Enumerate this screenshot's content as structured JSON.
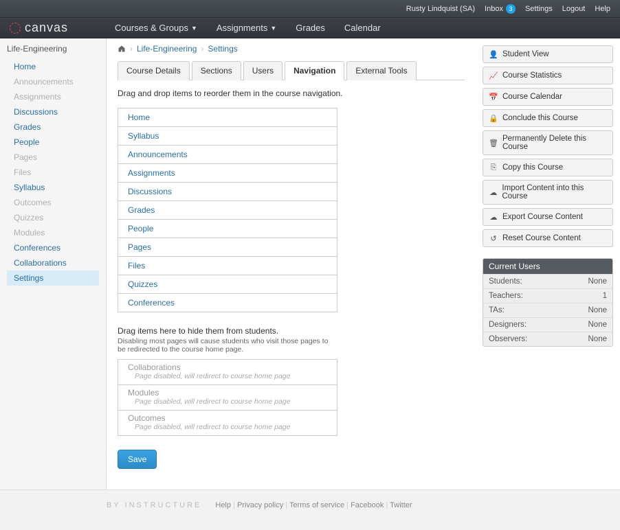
{
  "topbar": {
    "user": "Rusty Lindquist (SA)",
    "inbox_label": "Inbox",
    "inbox_count": "3",
    "settings": "Settings",
    "logout": "Logout",
    "help": "Help"
  },
  "brand": {
    "name": "canvas"
  },
  "mainnav": {
    "courses": "Courses & Groups",
    "assignments": "Assignments",
    "grades": "Grades",
    "calendar": "Calendar"
  },
  "sidebar": {
    "header": "Life-Engineering",
    "items": [
      {
        "label": "Home",
        "disabled": false
      },
      {
        "label": "Announcements",
        "disabled": true
      },
      {
        "label": "Assignments",
        "disabled": true
      },
      {
        "label": "Discussions",
        "disabled": false
      },
      {
        "label": "Grades",
        "disabled": false
      },
      {
        "label": "People",
        "disabled": false
      },
      {
        "label": "Pages",
        "disabled": true
      },
      {
        "label": "Files",
        "disabled": true
      },
      {
        "label": "Syllabus",
        "disabled": false
      },
      {
        "label": "Outcomes",
        "disabled": true
      },
      {
        "label": "Quizzes",
        "disabled": true
      },
      {
        "label": "Modules",
        "disabled": true
      },
      {
        "label": "Conferences",
        "disabled": false
      },
      {
        "label": "Collaborations",
        "disabled": false
      },
      {
        "label": "Settings",
        "disabled": false,
        "active": true
      }
    ]
  },
  "breadcrumbs": {
    "crumb1": "Life-Engineering",
    "crumb2": "Settings"
  },
  "tabs": {
    "t0": "Course Details",
    "t1": "Sections",
    "t2": "Users",
    "t3": "Navigation",
    "t4": "External Tools",
    "active": 3
  },
  "content": {
    "drag_instruction": "Drag and drop items to reorder them in the course navigation.",
    "nav_items": [
      "Home",
      "Syllabus",
      "Announcements",
      "Assignments",
      "Discussions",
      "Grades",
      "People",
      "Pages",
      "Files",
      "Quizzes",
      "Conferences"
    ],
    "hide_title": "Drag items here to hide them from students.",
    "hide_sub": "Disabling most pages will cause students who visit those pages to be redirected to the course home page.",
    "disabled_items": [
      "Collaborations",
      "Modules",
      "Outcomes"
    ],
    "disabled_sub": "Page disabled, will redirect to course home page",
    "save": "Save"
  },
  "right": {
    "buttons": [
      {
        "icon": "👤",
        "name": "student-view-icon",
        "label": "Student View"
      },
      {
        "icon": "📈",
        "name": "stats-icon",
        "label": "Course Statistics"
      },
      {
        "icon": "📅",
        "name": "calendar-icon",
        "label": "Course Calendar"
      },
      {
        "icon": "🔒",
        "name": "lock-icon",
        "label": "Conclude this Course"
      },
      {
        "icon": "🗑",
        "name": "trash-icon",
        "label": "Permanently Delete this Course"
      },
      {
        "icon": "⎘",
        "name": "copy-icon",
        "label": "Copy this Course"
      },
      {
        "icon": "☁",
        "name": "import-icon",
        "label": "Import Content into this Course"
      },
      {
        "icon": "☁",
        "name": "export-icon",
        "label": "Export Course Content"
      },
      {
        "icon": "↺",
        "name": "reset-icon",
        "label": "Reset Course Content"
      }
    ],
    "panel_title": "Current Users",
    "users": [
      {
        "role": "Students:",
        "count": "None"
      },
      {
        "role": "Teachers:",
        "count": "1"
      },
      {
        "role": "TAs:",
        "count": "None"
      },
      {
        "role": "Designers:",
        "count": "None"
      },
      {
        "role": "Observers:",
        "count": "None"
      }
    ]
  },
  "footer": {
    "brand": "BY INSTRUCTURE",
    "links": [
      "Help",
      "Privacy policy",
      "Terms of service",
      "Facebook",
      "Twitter"
    ]
  }
}
